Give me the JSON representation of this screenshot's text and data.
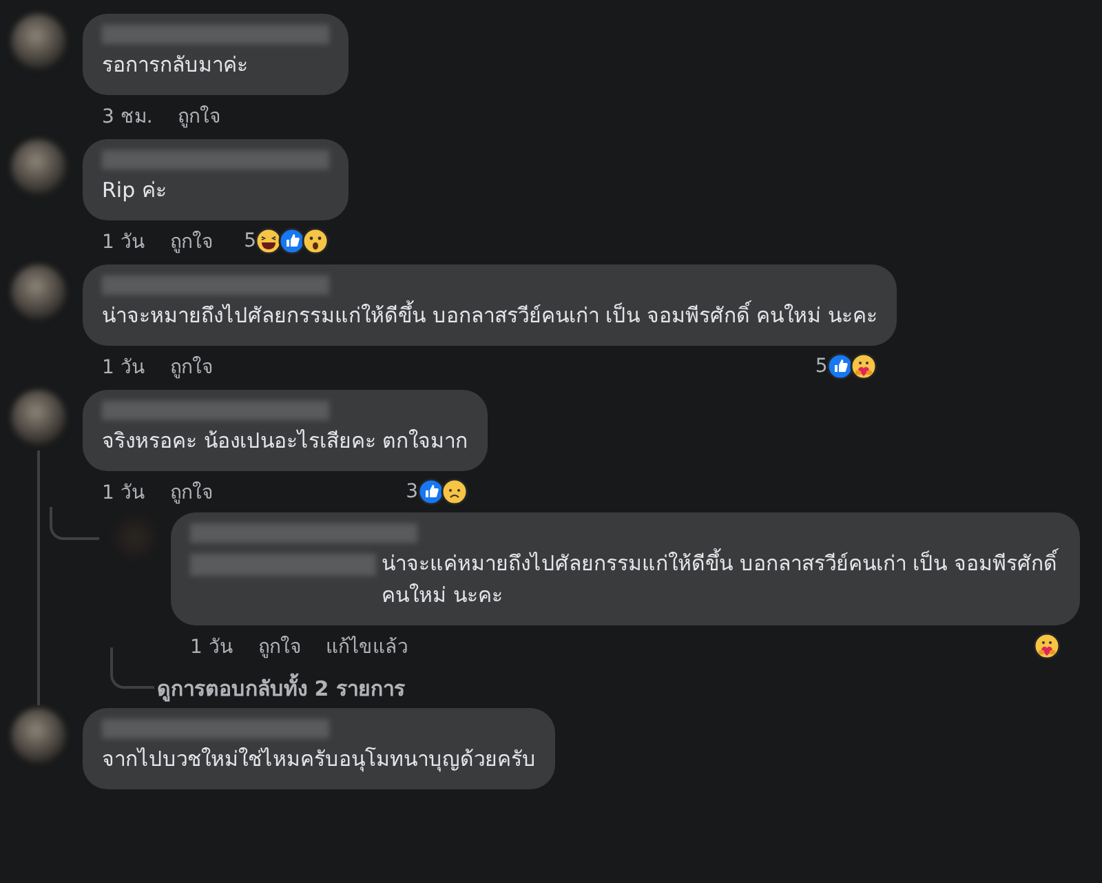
{
  "comments": [
    {
      "text": "รอการกลับมาค่ะ",
      "time": "3 ชม.",
      "like": "ถูกใจ"
    },
    {
      "text": "Rip ค่ะ",
      "time": "1 วัน",
      "like": "ถูกใจ",
      "reactions": {
        "count": "5",
        "icons": [
          {
            "kind": "haha"
          },
          {
            "kind": "like"
          },
          {
            "kind": "wow"
          }
        ]
      }
    },
    {
      "text": "น่าจะหมายถึงไปศัลยกรรมแก่ให้ดีขึ้น บอกลาสรวีย์คนเก่า เป็น จอมพีรศักดิ์ คนใหม่ นะคะ",
      "time": "1 วัน",
      "like": "ถูกใจ",
      "reactions": {
        "count": "5",
        "icons": [
          {
            "kind": "like"
          },
          {
            "kind": "care"
          }
        ]
      }
    },
    {
      "text": "จริงหรอคะ น้องเปนอะไรเสียคะ ตกใจมาก",
      "time": "1 วัน",
      "like": "ถูกใจ",
      "reactions": {
        "count": "3",
        "icons": [
          {
            "kind": "like"
          },
          {
            "kind": "sad"
          }
        ]
      },
      "replies": [
        {
          "text": "น่าจะแค่หมายถึงไปศัลยกรรมแก่ให้ดีขึ้น บอกลาสรวีย์คนเก่า เป็น จอมพีรศักดิ์ คนใหม่ นะคะ",
          "time": "1 วัน",
          "like": "ถูกใจ",
          "edited": "แก้ไขแล้ว",
          "reactions": {
            "icons": [
              {
                "kind": "care"
              }
            ]
          }
        }
      ],
      "more_replies": "ดูการตอบกลับทั้ง 2 รายการ"
    },
    {
      "text": "จากไปบวชใหม่ใช่ไหมครับอนุโมทนาบุญด้วยครับ"
    }
  ]
}
